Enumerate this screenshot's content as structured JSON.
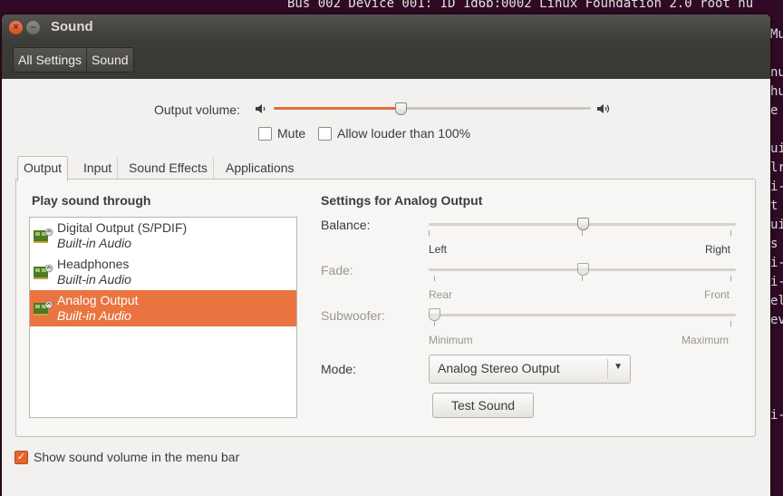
{
  "terminal": {
    "top_line": "Bus 002 Device 001: ID 1d6b:0002 Linux Foundation 2.0 root hu",
    "right_fragments": [
      "Mu",
      "",
      "nu",
      "hu",
      "e",
      "",
      "ui",
      "lr",
      "i-",
      "t",
      "ui",
      "s",
      "i-",
      "i-",
      "el",
      "ev",
      "",
      "",
      "",
      "",
      "i-"
    ]
  },
  "window": {
    "title": "Sound",
    "close_glyph": "×",
    "minimize_glyph": "–"
  },
  "breadcrumb": {
    "items": [
      "All Settings",
      "Sound"
    ]
  },
  "volume": {
    "label": "Output volume:",
    "level_fraction": 0.4,
    "low_icon": "speaker-low-icon",
    "high_icon": "speaker-high-icon",
    "mute_label": "Mute",
    "mute_checked": false,
    "louder_label": "Allow louder than 100%",
    "louder_checked": false
  },
  "tabs": [
    {
      "label": "Output",
      "active": true
    },
    {
      "label": "Input",
      "active": false
    },
    {
      "label": "Sound Effects",
      "active": false
    },
    {
      "label": "Applications",
      "active": false
    }
  ],
  "output": {
    "play_through_title": "Play sound through",
    "devices": [
      {
        "name": "Digital Output (S/PDIF)",
        "sub": "Built-in Audio",
        "selected": false
      },
      {
        "name": "Headphones",
        "sub": "Built-in Audio",
        "selected": false
      },
      {
        "name": "Analog Output",
        "sub": "Built-in Audio",
        "selected": true
      }
    ],
    "settings_title": "Settings for Analog Output",
    "balance": {
      "label": "Balance:",
      "left": "Left",
      "right": "Right",
      "value_fraction": 0.5
    },
    "fade": {
      "label": "Fade:",
      "left": "Rear",
      "right": "Front",
      "value_fraction": 0.5
    },
    "subwoofer": {
      "label": "Subwoofer:",
      "left": "Minimum",
      "right": "Maximum",
      "value_fraction": 0.0
    },
    "mode_label": "Mode:",
    "mode_value": "Analog Stereo Output",
    "test_button": "Test Sound"
  },
  "footer": {
    "show_in_menubar_label": "Show sound volume in the menu bar",
    "show_in_menubar_checked": true
  },
  "colors": {
    "accent": "#ea7440",
    "titlebar": "#3d3c38"
  }
}
